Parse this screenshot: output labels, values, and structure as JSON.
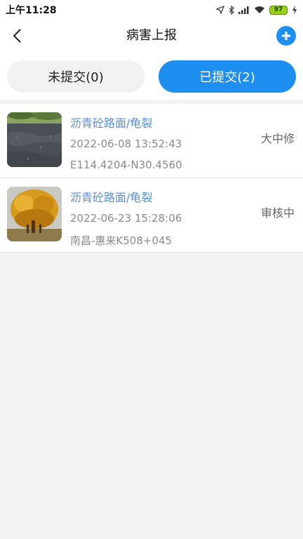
{
  "status_bar": {
    "time": "上午11:28",
    "battery": "97",
    "icons": [
      "location-icon",
      "bluetooth-icon",
      "signal-icon",
      "wifi-icon",
      "battery-icon",
      "charging-icon"
    ]
  },
  "nav": {
    "title": "病害上报",
    "back_icon": "chevron-left-icon",
    "add_icon": "plus-circle-icon"
  },
  "tabs": [
    {
      "label": "未提交(0)",
      "active": false
    },
    {
      "label": "已提交(2)",
      "active": true
    }
  ],
  "reports": [
    {
      "title": "沥青砼路面/龟裂",
      "time": "2022-06-08 13:52:43",
      "location": "E114.4204-N30.4560",
      "status": "大中修"
    },
    {
      "title": "沥青砼路面/龟裂",
      "time": "2022-06-23 15:28:06",
      "location": "南昌-惠来K508+045",
      "status": "审核中"
    }
  ],
  "colors": {
    "accent": "#1e8ff0",
    "title_link": "#5b8ed1",
    "meta_text": "#8a8a8a",
    "background": "#f3f3f3"
  }
}
